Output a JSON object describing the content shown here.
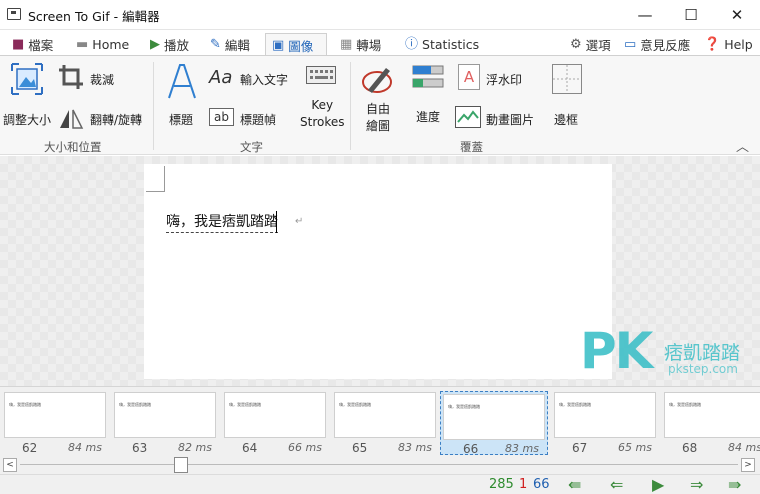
{
  "window": {
    "title": "Screen To Gif - 編輯器",
    "minimize": "—",
    "maximize": "☐",
    "close": "✕"
  },
  "tabs": [
    {
      "label": "檔案",
      "icon": "save-icon"
    },
    {
      "label": "Home",
      "icon": "home-icon"
    },
    {
      "label": "播放",
      "icon": "play-icon"
    },
    {
      "label": "編輯",
      "icon": "pencil-icon"
    },
    {
      "label": "圖像",
      "icon": "image-icon",
      "active": true
    },
    {
      "label": "轉場",
      "icon": "transition-icon"
    },
    {
      "label": "Statistics",
      "icon": "info-icon"
    }
  ],
  "tabbar_right": {
    "options": "選項",
    "feedback": "意見反應",
    "help": "Help"
  },
  "ribbon": {
    "size_group": {
      "label": "大小和位置",
      "resize": "調整大小",
      "crop": "裁減",
      "flip_rotate": "翻轉/旋轉"
    },
    "text_group": {
      "label": "文字",
      "caption": "標題",
      "free_text": "輸入文字",
      "title_frame": "標題幀",
      "key_strokes": "Key\nStrokes"
    },
    "overlay_group": {
      "label": "覆蓋",
      "free_drawing": "自由\n繪圖",
      "progress": "進度",
      "watermark": "浮水印",
      "cinemagraph": "動畫圖片",
      "border": "邊框"
    }
  },
  "canvas": {
    "document_text": "嗨，我是痞凱踏踏",
    "watermark_logo": "PK",
    "watermark_text": "痞凱踏踏",
    "watermark_sub": "pkstep.com"
  },
  "frames": [
    {
      "number": "62",
      "duration": "84 ms",
      "mini_text": "嗨，我是痞凱踏踏"
    },
    {
      "number": "63",
      "duration": "82 ms",
      "mini_text": "嗨，我是痞凱踏踏"
    },
    {
      "number": "64",
      "duration": "66 ms",
      "mini_text": "嗨，我是痞凱踏踏"
    },
    {
      "number": "65",
      "duration": "83 ms",
      "mini_text": "嗨，我是痞凱踏踏"
    },
    {
      "number": "66",
      "duration": "83 ms",
      "mini_text": "嗨，我是痞凱踏踏",
      "selected": true
    },
    {
      "number": "67",
      "duration": "65 ms",
      "mini_text": "嗨，我是痞凱踏踏"
    },
    {
      "number": "68",
      "duration": "84 ms",
      "mini_text": "嗨，我是痞凱踏踏"
    }
  ],
  "status": {
    "total_frames": "285",
    "selected_count": "1",
    "current_frame": "66"
  },
  "colors": {
    "accent": "#1e63b8",
    "nav_green": "#3c8b3c",
    "count_green": "#2e8b2e",
    "count_red": "#d02020",
    "count_blue": "#1f5fb0",
    "watermark_teal": "#3fc0c8"
  }
}
